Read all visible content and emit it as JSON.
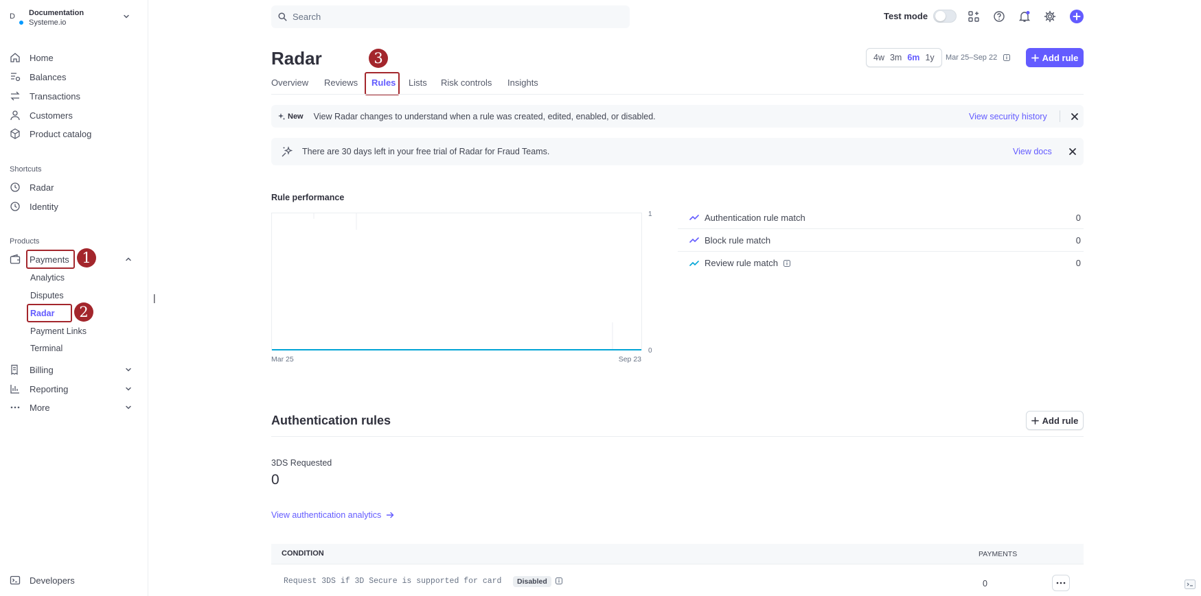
{
  "account": {
    "name": "Documentation",
    "company": "Systeme.io",
    "initial": "D"
  },
  "sidebar": {
    "items": [
      {
        "label": "Home",
        "icon": "home-icon"
      },
      {
        "label": "Balances",
        "icon": "balances-icon"
      },
      {
        "label": "Transactions",
        "icon": "transactions-icon"
      },
      {
        "label": "Customers",
        "icon": "customers-icon"
      },
      {
        "label": "Product catalog",
        "icon": "product-catalog-icon"
      }
    ],
    "shortcuts_label": "Shortcuts",
    "shortcuts": [
      {
        "label": "Radar",
        "icon": "clock-icon"
      },
      {
        "label": "Identity",
        "icon": "clock-icon"
      }
    ],
    "products_label": "Products",
    "payments_label": "Payments",
    "payments_sub": [
      "Analytics",
      "Disputes",
      "Radar",
      "Payment Links",
      "Terminal"
    ],
    "billing_label": "Billing",
    "reporting_label": "Reporting",
    "more_label": "More",
    "developers_label": "Developers"
  },
  "annotations": [
    "1",
    "2",
    "3"
  ],
  "search": {
    "placeholder": "Search"
  },
  "topbar": {
    "test_mode_label": "Test mode",
    "test_mode_on": false
  },
  "header": {
    "title": "Radar",
    "tabs": [
      "Overview",
      "Reviews",
      "Rules",
      "Lists",
      "Risk controls",
      "Insights"
    ],
    "active_tab": "Rules",
    "ranges": [
      "4w",
      "3m",
      "6m",
      "1y"
    ],
    "selected_range": "6m",
    "range_label": "Mar 25–Sep 22",
    "add_rule_label": "Add rule"
  },
  "banner_new": {
    "badge": "New",
    "text": "View Radar changes to understand when a rule was created, edited, enabled, or disabled.",
    "link": "View security history"
  },
  "banner_trial": {
    "text": "There are 30 days left in your free trial of Radar for Fraud Teams.",
    "link": "View docs"
  },
  "performance": {
    "title": "Rule performance",
    "legend": [
      {
        "label": "Authentication rule match",
        "value": "0",
        "color": "#635bff"
      },
      {
        "label": "Block rule match",
        "value": "0",
        "color": "#635bff"
      },
      {
        "label": "Review rule match",
        "value": "0",
        "color": "#00a4d6"
      }
    ]
  },
  "chart_data": {
    "type": "line",
    "x": [
      "Mar 25",
      "Sep 23"
    ],
    "series": [
      {
        "values": [
          0,
          0
        ]
      }
    ],
    "ylim": [
      0,
      1
    ],
    "ytick_labels": [
      "1",
      "0"
    ],
    "xtick_labels": [
      "Mar 25",
      "Sep 23"
    ],
    "line_color": "#00a4d6"
  },
  "auth_rules": {
    "title": "Authentication rules",
    "add_rule_label": "Add rule",
    "stat_label": "3DS Requested",
    "stat_value": "0",
    "link": "View authentication analytics",
    "columns": [
      "CONDITION",
      "PAYMENTS"
    ],
    "rows": [
      {
        "condition": "Request 3DS if 3D Secure is supported for card",
        "status": "Disabled",
        "payments": "0"
      }
    ]
  },
  "cursor_glyph": "|"
}
